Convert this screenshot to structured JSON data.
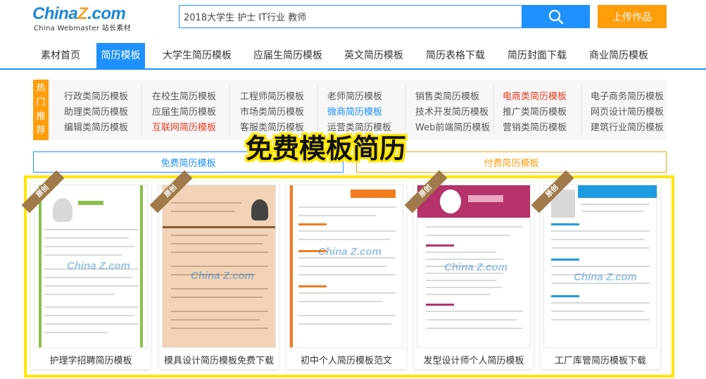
{
  "header": {
    "logo_main_a": "China",
    "logo_main_z": "Z",
    "logo_main_b": ".com",
    "logo_sub": "China Webmaster 站长素材",
    "search_value": "2018大学生 护士 IT行业 教师",
    "search_icon": "search-icon",
    "upload_label": "上传作品"
  },
  "nav": {
    "items": [
      "素材首页",
      "简历模板",
      "大学生简历模板",
      "应届生简历模板",
      "英文简历模板",
      "简历表格下载",
      "简历封面下载",
      "商业简历模板"
    ],
    "active_index": 1,
    "accent": "#1e90ff"
  },
  "hot": {
    "label": [
      "热",
      "门",
      "推",
      "荐"
    ],
    "columns": [
      [
        "行政类简历模板",
        "助理类简历模板",
        "编辑类简历模板"
      ],
      [
        "在校生简历模板",
        "应届生简历模板",
        "互联网简历模板"
      ],
      [
        "工程师简历模板",
        "市场类简历模板",
        "客服类简历模板"
      ],
      [
        "老师简历模板",
        "微商简历模板",
        "运营类简历模板"
      ],
      [
        "销售类简历模板",
        "技术开发简历模板",
        "Web前端简历模板"
      ],
      [
        "电商类简历模板",
        "推广类简历模板",
        "营销类简历模板"
      ],
      [
        "电子商务简历模板",
        "网页设计简历模板",
        "建筑行业简历模板"
      ]
    ],
    "label_color": "#ff9d0b"
  },
  "overlay_title": "免费模板简历",
  "tabs": {
    "free": "免费简历模板",
    "paid": "付费简历模板"
  },
  "badge_text": "原创",
  "watermark": "China Z.com",
  "cards": [
    {
      "caption": "护理学招聘简历模板",
      "theme": "#8cbf4a"
    },
    {
      "caption": "模具设计简历模板免费下载",
      "theme": "#f2d3b6"
    },
    {
      "caption": "初中个人简历模板范文",
      "theme": "#f07d1e"
    },
    {
      "caption": "发型设计师个人简历模板",
      "theme": "#b5326a"
    },
    {
      "caption": "工厂库管简历模板下载",
      "theme": "#1e9ae0"
    }
  ],
  "colors": {
    "primary": "#1e90ff",
    "orange": "#ff9d0b",
    "highlight": "#ffe600",
    "hot_red": "#e8381e"
  }
}
